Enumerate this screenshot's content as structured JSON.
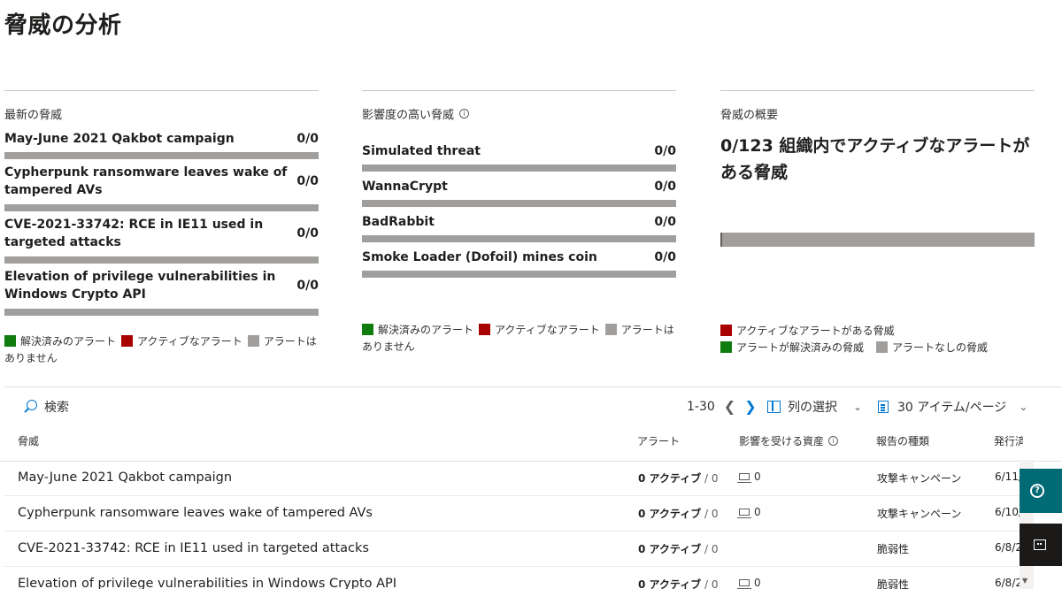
{
  "page": {
    "title": "脅威の分析"
  },
  "latest": {
    "title": "最新の脅威",
    "items": [
      {
        "name": "May-June 2021 Qakbot campaign",
        "count": "0/0"
      },
      {
        "name": "Cypherpunk ransomware leaves wake of tampered AVs",
        "count": "0/0"
      },
      {
        "name": "CVE-2021-33742: RCE in IE11 used in targeted attacks",
        "count": "0/0"
      },
      {
        "name": "Elevation of privilege vulnerabilities in Windows Crypto API",
        "count": "0/0"
      }
    ],
    "legend": {
      "resolved": "解決済みのアラート",
      "active": "アクティブなアラート",
      "none": "アラートはありません"
    }
  },
  "impact": {
    "title": "影響度の高い脅威",
    "items": [
      {
        "name": "Simulated threat",
        "count": "0/0"
      },
      {
        "name": "WannaCrypt",
        "count": "0/0"
      },
      {
        "name": "BadRabbit",
        "count": "0/0"
      },
      {
        "name": "Smoke Loader (Dofoil) mines coin",
        "count": "0/0"
      }
    ],
    "legend": {
      "resolved": "解決済みのアラート",
      "active": "アクティブなアラート",
      "none": "アラートはありません"
    }
  },
  "overview": {
    "title": "脅威の概要",
    "headline": "0/123 組織内でアクティブなアラートがある脅威",
    "legend": {
      "active": "アクティブなアラートがある脅威",
      "resolved": "アラートが解決済みの脅威",
      "none": "アラートなしの脅威"
    }
  },
  "toolbar": {
    "search_label": "検索",
    "range": "1-30",
    "column_select": "列の選択",
    "per_page": "30 アイテム/ページ"
  },
  "table": {
    "headers": {
      "threat": "脅威",
      "alerts": "アラート",
      "assets": "影響を受ける資産",
      "report_type": "報告の種類",
      "published": "発行済"
    },
    "rows": [
      {
        "name": "May-June 2021 Qakbot campaign",
        "active": "0 アクティブ",
        "total": "/ 0",
        "assets": "0",
        "type": "攻撃キャンペーン",
        "date": "6/11/"
      },
      {
        "name": "Cypherpunk ransomware leaves wake of tampered AVs",
        "active": "0 アクティブ",
        "total": "/ 0",
        "assets": "0",
        "type": "攻撃キャンペーン",
        "date": "6/10/"
      },
      {
        "name": "CVE-2021-33742: RCE in IE11 used in targeted attacks",
        "active": "0 アクティブ",
        "total": "/ 0",
        "assets": "",
        "type": "脆弱性",
        "date": "6/8/2"
      },
      {
        "name": "Elevation of privilege vulnerabilities in Windows Crypto API",
        "active": "0 アクティブ",
        "total": "/ 0",
        "assets": "0",
        "type": "脆弱性",
        "date": "6/8/2"
      }
    ]
  },
  "colors": {
    "resolved": "#107c10",
    "active": "#a80000",
    "none": "#a19f9d",
    "accent": "#0078d4"
  }
}
